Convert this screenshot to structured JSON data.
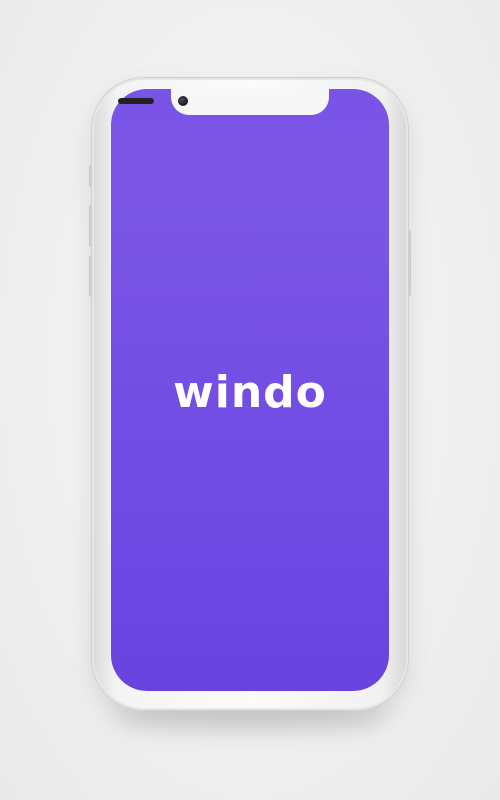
{
  "app": {
    "logo_text": "windo"
  },
  "theme": {
    "screen_color_top": "#7a54e6",
    "screen_color_bottom": "#6a43df",
    "device_color": "#f4f4f4"
  }
}
